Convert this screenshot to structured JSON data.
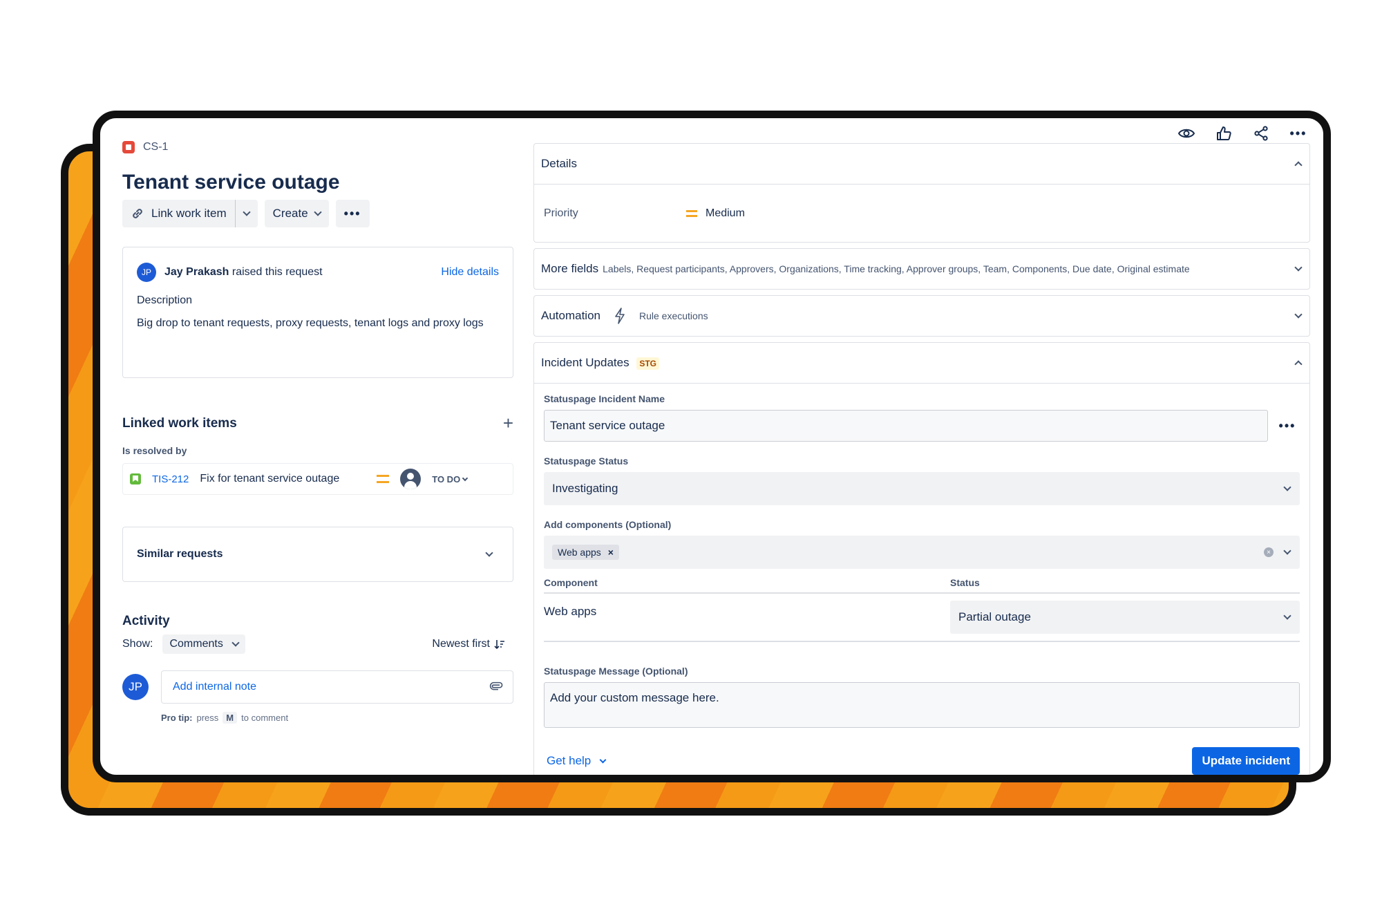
{
  "issue": {
    "key": "CS-1",
    "title": "Tenant service outage",
    "toolbar": {
      "link_label": "Link work item",
      "create_label": "Create"
    }
  },
  "request": {
    "avatar_initials": "JP",
    "user_name": "Jay Prakash",
    "raised_text": "raised this request",
    "hide_details": "Hide details",
    "description_label": "Description",
    "description": "Big drop to tenant requests, proxy requests, tenant logs and proxy logs"
  },
  "linked": {
    "title": "Linked work items",
    "relation": "Is resolved by",
    "items": [
      {
        "key": "TIS-212",
        "summary": "Fix for tenant service outage",
        "status": "TO DO"
      }
    ]
  },
  "similar": {
    "title": "Similar requests"
  },
  "activity": {
    "title": "Activity",
    "show_label": "Show:",
    "filter": "Comments",
    "sort": "Newest first",
    "avatar_initials": "JP",
    "placeholder": "Add internal note",
    "protip_label": "Pro tip:",
    "protip_press": "press",
    "protip_key": "M",
    "protip_after": "to comment"
  },
  "details": {
    "title": "Details",
    "priority_label": "Priority",
    "priority_value": "Medium"
  },
  "more_fields": {
    "title": "More fields",
    "list": "Labels, Request participants, Approvers, Organizations, Time tracking, Approver groups, Team, Components, Due date, Original estimate"
  },
  "automation": {
    "title": "Automation",
    "sub": "Rule executions"
  },
  "incident": {
    "title": "Incident Updates",
    "badge": "STG",
    "name_label": "Statuspage Incident Name",
    "name_value": "Tenant service outage",
    "status_label": "Statuspage Status",
    "status_value": "Investigating",
    "components_label": "Add components (Optional)",
    "components_selected": [
      "Web apps"
    ],
    "table_head": {
      "component": "Component",
      "status": "Status"
    },
    "component_rows": [
      {
        "component": "Web apps",
        "status": "Partial outage"
      }
    ],
    "message_label": "Statuspage Message (Optional)",
    "message_value": "Add your custom message here.",
    "help_label": "Get help",
    "submit_label": "Update incident"
  },
  "colors": {
    "accent": "#0c66e4",
    "priority_medium": "#f5a623",
    "issue_type": "#e5493a",
    "story": "#63ba3c",
    "frame_orange": "#f07c13"
  },
  "icons": [
    "watch-icon",
    "like-icon",
    "share-icon",
    "more-icon",
    "link-icon",
    "bolt-icon",
    "attachment-icon",
    "sort-icon"
  ]
}
